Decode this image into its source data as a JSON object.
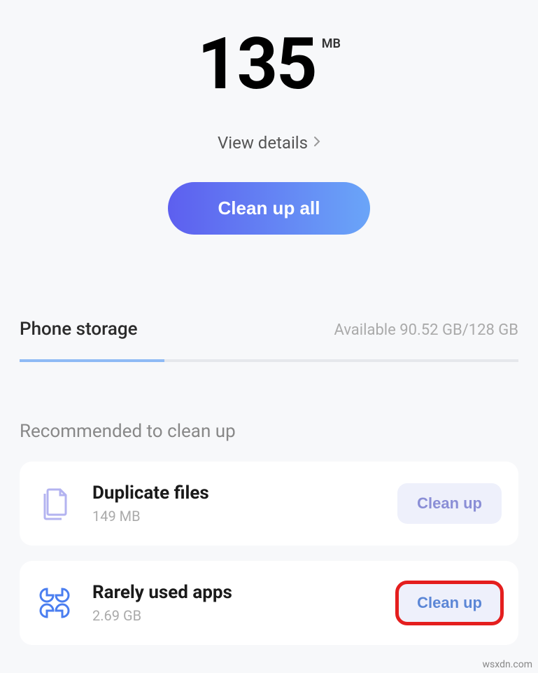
{
  "header": {
    "size_value": "135",
    "size_unit": "MB",
    "view_details_label": "View details",
    "clean_all_label": "Clean up all"
  },
  "storage": {
    "title": "Phone storage",
    "available_text": "Available 90.52 GB/128 GB",
    "used_percent": 29
  },
  "recommend": {
    "title": "Recommended to clean up",
    "items": [
      {
        "icon": "duplicate-files-icon",
        "title": "Duplicate files",
        "subtitle": "149 MB",
        "button_label": "Clean up",
        "highlighted": false
      },
      {
        "icon": "apps-icon",
        "title": "Rarely used apps",
        "subtitle": "2.69 GB",
        "button_label": "Clean up",
        "highlighted": true
      }
    ]
  },
  "watermark": "wsxdn.com"
}
